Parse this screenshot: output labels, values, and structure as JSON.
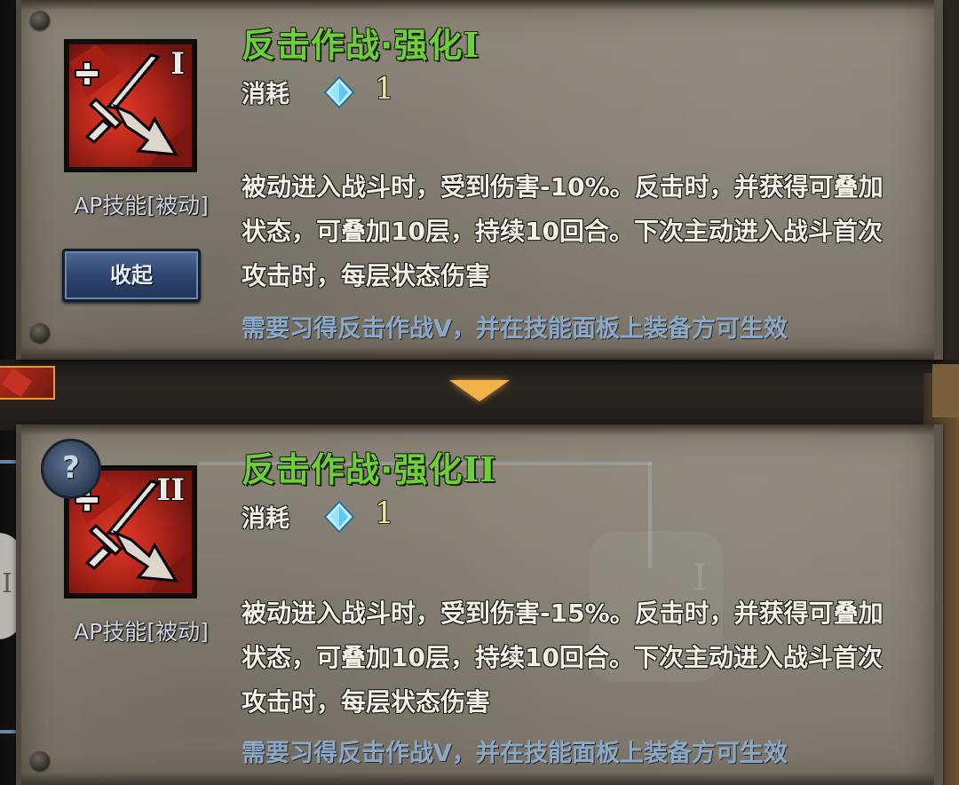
{
  "skills": [
    {
      "title": "反击作战·强化I",
      "title_main": "反击作战·强化",
      "title_numeral": "I",
      "icon_numeral": "I",
      "type_label": "AP技能[被动]",
      "cost_label": "消耗",
      "cost_value": "1",
      "description": "被动进入战斗时，受到伤害-10%。反击时，并获得可叠加状态，可叠加10层，持续10回合。下次主动进入战斗首次攻击时，每层状态伤害",
      "requirement": "需要习得反击作战V，并在技能面板上装备方可生效",
      "collapse_label": "收起"
    },
    {
      "title": "反击作战·强化II",
      "title_main": "反击作战·强化",
      "title_numeral": "II",
      "icon_numeral": "II",
      "type_label": "AP技能[被动]",
      "cost_label": "消耗",
      "cost_value": "1",
      "description": "被动进入战斗时，受到伤害-15%。反击时，并获得可叠加状态，可叠加10层，持续10回合。下次主动进入战斗首次攻击时，每层状态伤害",
      "requirement": "需要习得反击作战V，并在技能面板上装备方可生效",
      "help_label": "?"
    }
  ],
  "background": {
    "side_numeral": "I",
    "watermark_numeral": "I"
  },
  "colors": {
    "title_green": "#6fcf3b",
    "requirement_blue": "#8aa8c8",
    "icon_red": "#c53224",
    "arrow_orange": "#f2b24a"
  },
  "icons": [
    "sword-arrow-skill-icon",
    "diamond-gem-icon",
    "help-question-icon",
    "expand-arrow-icon"
  ]
}
